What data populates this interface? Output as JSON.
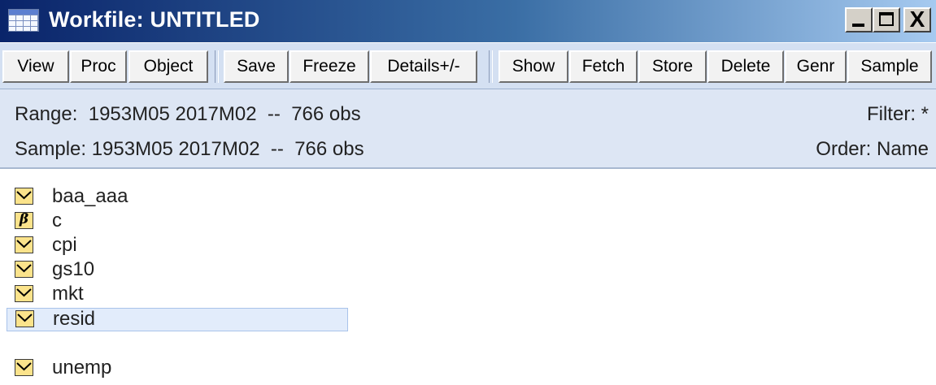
{
  "window": {
    "title": "Workfile: UNTITLED",
    "title_icon": "workfile-grid-icon",
    "controls": {
      "minimize": "_",
      "maximize": "□",
      "close": "X"
    }
  },
  "toolbar": {
    "buttons": [
      "View",
      "Proc",
      "Object",
      "Save",
      "Freeze",
      "Details+/-",
      "Show",
      "Fetch",
      "Store",
      "Delete",
      "Genr",
      "Sample"
    ]
  },
  "info": {
    "range_text": "Range:  1953M05 2017M02  --  766 obs",
    "sample_text": "Sample: 1953M05 2017M02  --  766 obs",
    "filter_text": "Filter: *",
    "order_text": "Order: Name"
  },
  "objects": [
    {
      "name": "baa_aaa",
      "icon": "series-icon",
      "selected": false
    },
    {
      "name": "c",
      "icon": "coefficient-icon",
      "selected": false
    },
    {
      "name": "cpi",
      "icon": "series-icon",
      "selected": false
    },
    {
      "name": "gs10",
      "icon": "series-icon",
      "selected": false
    },
    {
      "name": "mkt",
      "icon": "series-icon",
      "selected": false
    },
    {
      "name": "resid",
      "icon": "series-icon",
      "selected": true
    },
    {
      "name": "unemp",
      "icon": "series-icon",
      "selected": false
    }
  ],
  "colors": {
    "titlebar_start": "#0a246a",
    "titlebar_end": "#a6caf0",
    "toolbar_bg": "#d4e0f2",
    "info_bg": "#dde6f4",
    "icon_fill": "#fbe38b",
    "selection_bg": "#e2ecfb"
  }
}
